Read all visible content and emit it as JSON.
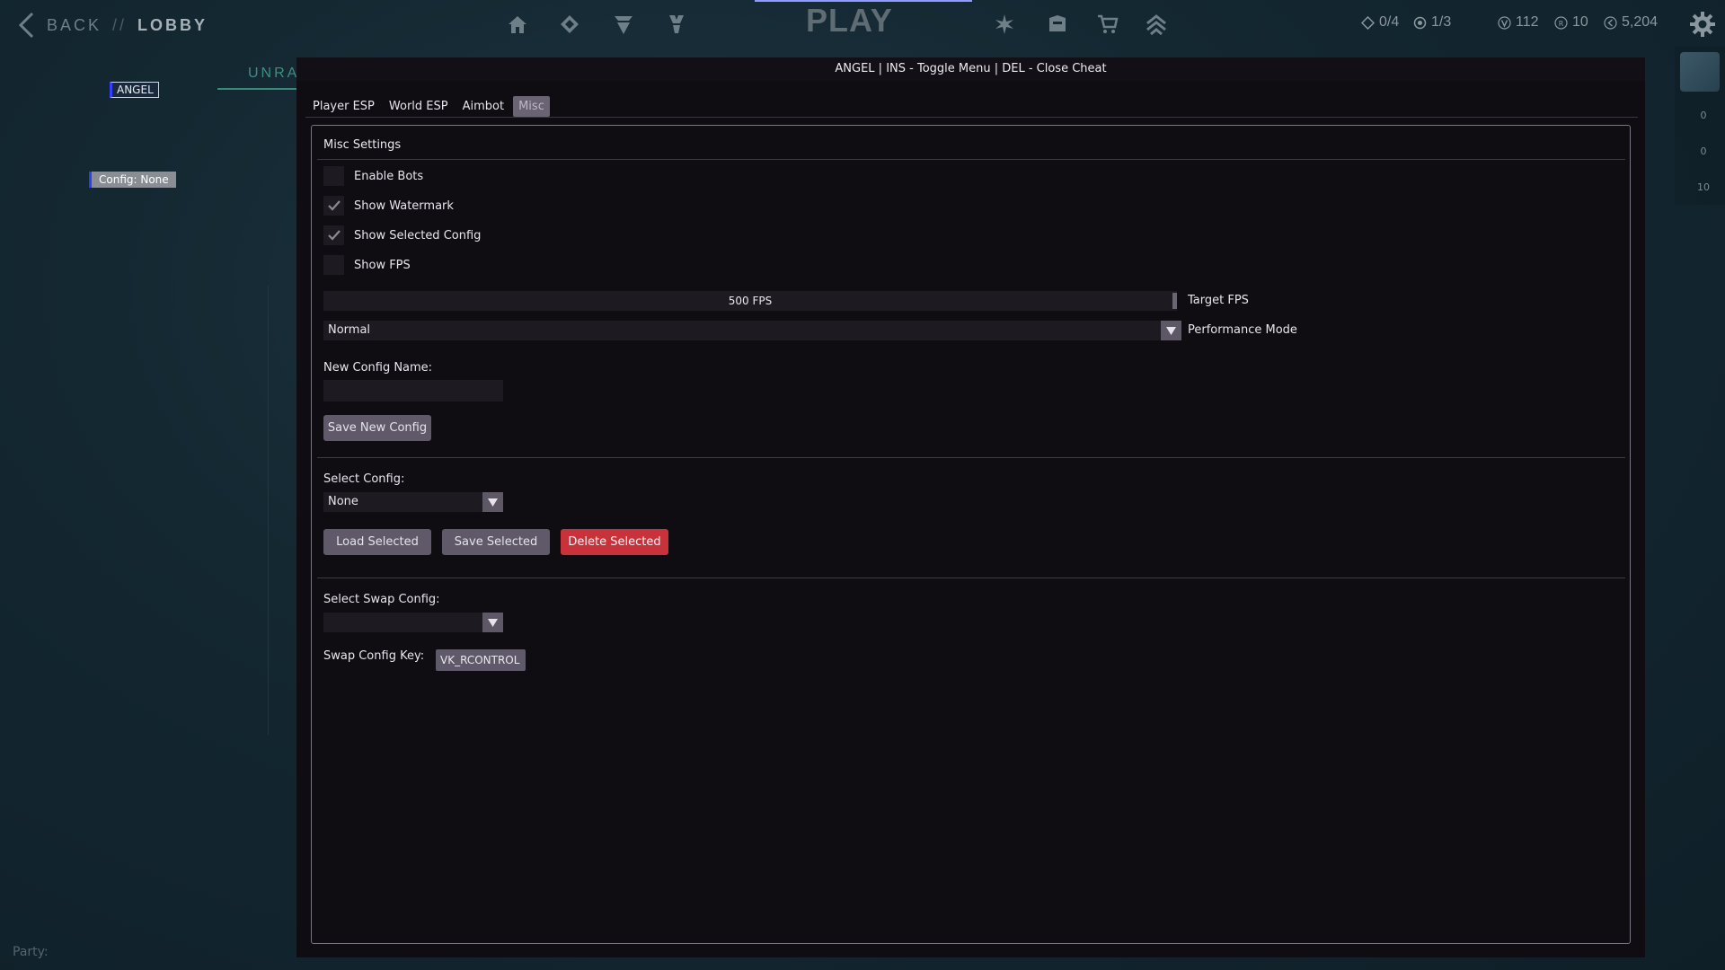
{
  "topbar": {
    "back_label": "BACK",
    "separator": "//",
    "lobby_label": "LOBBY",
    "play_label": "PLAY",
    "nav_icons": [
      "home-icon",
      "career-icon",
      "agents-icon",
      "battlepass-icon",
      "collection-icon",
      "loadout-icon",
      "store-icon",
      "rank-icon"
    ],
    "stats": [
      {
        "icon": "social-icon",
        "value": "0/4"
      },
      {
        "icon": "party-icon",
        "value": "1/3"
      },
      {
        "icon": "valorant-points-icon",
        "value": "112"
      },
      {
        "icon": "radianite-icon",
        "value": "10"
      },
      {
        "icon": "kingdom-credits-icon",
        "value": "5,204"
      }
    ]
  },
  "background": {
    "mode_label": "UNRAT",
    "party_label": "Party:",
    "side_numbers": [
      "0",
      "0",
      "10"
    ]
  },
  "overlay": {
    "username": "ANGEL",
    "config_tag": "Config: None"
  },
  "window": {
    "title": "ANGEL | INS - Toggle Menu | DEL - Close Cheat",
    "tabs": [
      "Player ESP",
      "World ESP",
      "Aimbot",
      "Misc"
    ],
    "active_tab": "Misc"
  },
  "misc": {
    "section_title": "Misc Settings",
    "checkboxes": [
      {
        "label": "Enable Bots",
        "checked": false
      },
      {
        "label": "Show Watermark",
        "checked": true
      },
      {
        "label": "Show Selected Config",
        "checked": true
      },
      {
        "label": "Show FPS",
        "checked": false
      }
    ],
    "target_fps": {
      "value_text": "500 FPS",
      "label": "Target FPS",
      "fraction": 1.0
    },
    "performance_mode": {
      "selected": "Normal",
      "label": "Performance Mode"
    },
    "new_config": {
      "label": "New Config Name:",
      "value": "",
      "save_button": "Save New Config"
    },
    "select_config": {
      "label": "Select Config:",
      "selected": "None"
    },
    "buttons": {
      "load": "Load Selected",
      "save": "Save Selected",
      "delete": "Delete Selected"
    },
    "swap_config": {
      "label": "Select Swap Config:",
      "selected": ""
    },
    "swap_key": {
      "label": "Swap Config Key:",
      "value": "VK_RCONTROL"
    }
  },
  "colors": {
    "accent_red": "#c8323a",
    "button_gray": "#5f5969",
    "window_bg": "#0f0d12"
  }
}
